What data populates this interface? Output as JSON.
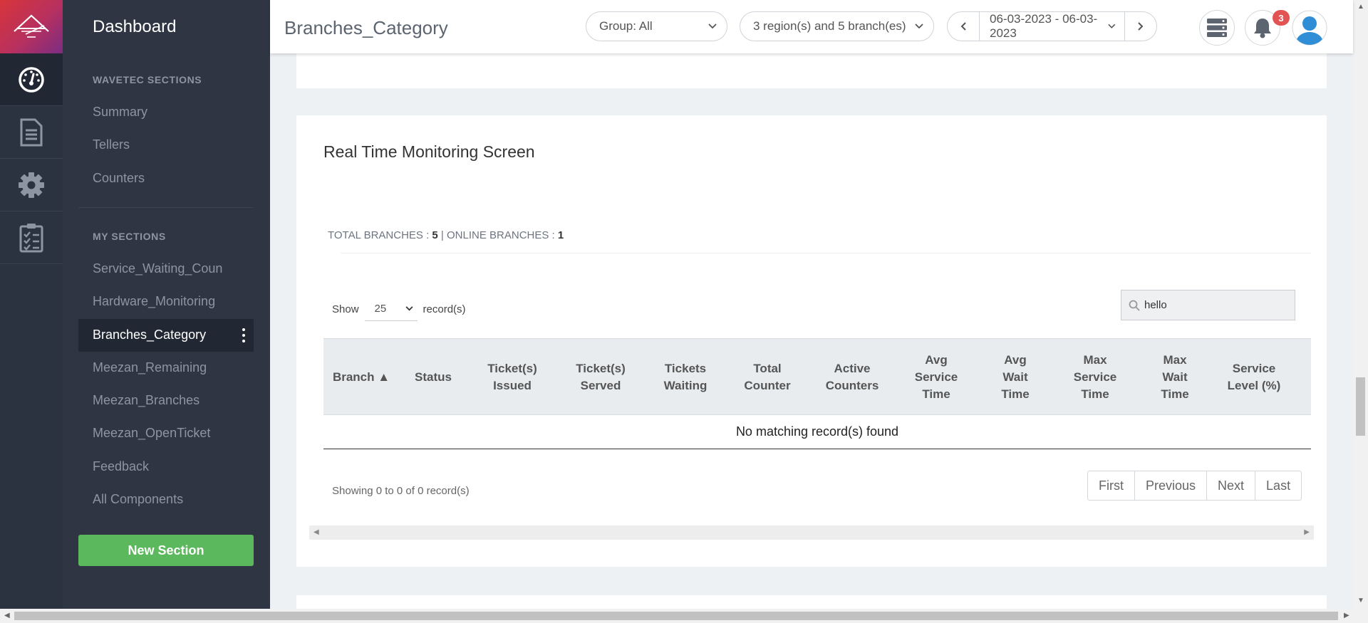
{
  "sidebar": {
    "title": "Dashboard",
    "section1_title": "WAVETEC SECTIONS",
    "section1_items": [
      "Summary",
      "Tellers",
      "Counters"
    ],
    "section2_title": "MY SECTIONS",
    "section2_items": [
      "Service_Waiting_Coun",
      "Hardware_Monitoring",
      "Branches_Category",
      "Meezan_Remaining",
      "Meezan_Branches",
      "Meezan_OpenTicket",
      "Feedback",
      "All Components"
    ],
    "active_item": "Branches_Category",
    "new_section_label": "New Section"
  },
  "rail": {
    "icons": [
      "dashboard-gauge-icon",
      "document-icon",
      "gear-icon",
      "checklist-icon"
    ]
  },
  "header": {
    "page_title": "Branches_Category",
    "group_filter": "Group: All",
    "region_filter": "3 region(s) and 5 branch(es)",
    "date_range": "06-03-2023 - 06-03-2023",
    "notification_count": "3"
  },
  "monitor": {
    "title": "Real Time Monitoring Screen",
    "total_label": "TOTAL BRANCHES : ",
    "total_value": "5",
    "separator": " | ",
    "online_label": "ONLINE BRANCHES : ",
    "online_value": "1",
    "show_label": "Show",
    "page_size": "25",
    "records_label": "record(s)",
    "search_value": "hello",
    "columns": [
      "Branch ▲",
      "Status",
      "Ticket(s)\nIssued",
      "Ticket(s)\nServed",
      "Tickets\nWaiting",
      "Total\nCounter",
      "Active\nCounters",
      "Avg\nService\nTime",
      "Avg\nWait\nTime",
      "Max\nService\nTime",
      "Max\nWait\nTime",
      "Service\nLevel (%)"
    ],
    "empty_message": "No matching record(s) found",
    "showing_text": "Showing 0 to 0 of 0 record(s)",
    "pagination": [
      "First",
      "Previous",
      "Next",
      "Last"
    ]
  },
  "colors": {
    "rail_bg": "#2c3340",
    "sidebar_bg": "#2f3542",
    "accent_green": "#5cb85c",
    "badge_red": "#e25454"
  }
}
